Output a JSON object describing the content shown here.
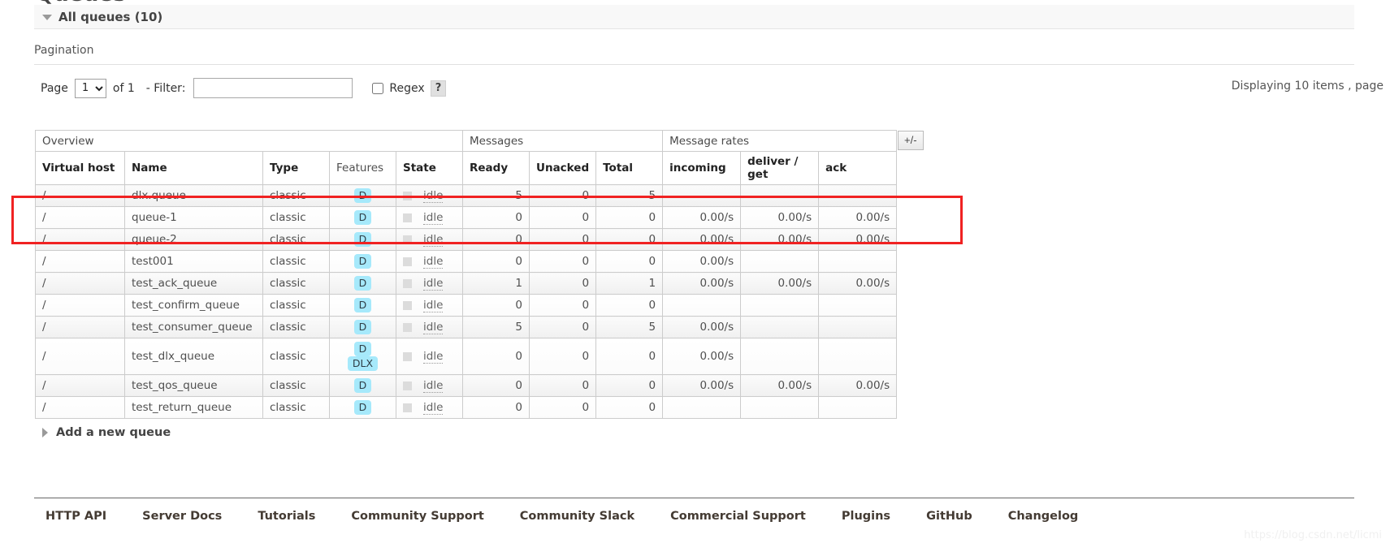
{
  "page_title": "Queues",
  "section": {
    "toggle_icon": "triangle-down-icon",
    "title": "All queues (10)"
  },
  "pagination": {
    "label": "Pagination",
    "page_label": "Page",
    "page_value": "1",
    "page_options": [
      "1"
    ],
    "of_label": "of 1",
    "filter_label": "- Filter:",
    "filter_value": "",
    "filter_placeholder": "",
    "regex_label": "Regex",
    "regex_checked": false,
    "help_label": "?",
    "displaying": "Displaying 10 items , page"
  },
  "table": {
    "group_headers": [
      "Overview",
      "Messages",
      "Message rates"
    ],
    "columns": [
      "Virtual host",
      "Name",
      "Type",
      "Features",
      "State",
      "Ready",
      "Unacked",
      "Total",
      "incoming",
      "deliver / get",
      "ack"
    ],
    "toggle_columns_label": "+/-",
    "state_text": "idle",
    "rows": [
      {
        "vhost": "/",
        "name": "dlx.queue",
        "type": "classic",
        "features": [
          "D"
        ],
        "state": "idle",
        "ready": "5",
        "unacked": "0",
        "total": "5",
        "incoming": "",
        "deliver_get": "",
        "ack": "",
        "highlighted": false
      },
      {
        "vhost": "/",
        "name": "queue-1",
        "type": "classic",
        "features": [
          "D"
        ],
        "state": "idle",
        "ready": "0",
        "unacked": "0",
        "total": "0",
        "incoming": "0.00/s",
        "deliver_get": "0.00/s",
        "ack": "0.00/s",
        "highlighted": true
      },
      {
        "vhost": "/",
        "name": "queue-2",
        "type": "classic",
        "features": [
          "D"
        ],
        "state": "idle",
        "ready": "0",
        "unacked": "0",
        "total": "0",
        "incoming": "0.00/s",
        "deliver_get": "0.00/s",
        "ack": "0.00/s",
        "highlighted": true
      },
      {
        "vhost": "/",
        "name": "test001",
        "type": "classic",
        "features": [
          "D"
        ],
        "state": "idle",
        "ready": "0",
        "unacked": "0",
        "total": "0",
        "incoming": "0.00/s",
        "deliver_get": "",
        "ack": "",
        "highlighted": false
      },
      {
        "vhost": "/",
        "name": "test_ack_queue",
        "type": "classic",
        "features": [
          "D"
        ],
        "state": "idle",
        "ready": "1",
        "unacked": "0",
        "total": "1",
        "incoming": "0.00/s",
        "deliver_get": "0.00/s",
        "ack": "0.00/s",
        "highlighted": false
      },
      {
        "vhost": "/",
        "name": "test_confirm_queue",
        "type": "classic",
        "features": [
          "D"
        ],
        "state": "idle",
        "ready": "0",
        "unacked": "0",
        "total": "0",
        "incoming": "",
        "deliver_get": "",
        "ack": "",
        "highlighted": false
      },
      {
        "vhost": "/",
        "name": "test_consumer_queue",
        "type": "classic",
        "features": [
          "D"
        ],
        "state": "idle",
        "ready": "5",
        "unacked": "0",
        "total": "5",
        "incoming": "0.00/s",
        "deliver_get": "",
        "ack": "",
        "highlighted": false
      },
      {
        "vhost": "/",
        "name": "test_dlx_queue",
        "type": "classic",
        "features": [
          "D",
          "DLX"
        ],
        "state": "idle",
        "ready": "0",
        "unacked": "0",
        "total": "0",
        "incoming": "0.00/s",
        "deliver_get": "",
        "ack": "",
        "highlighted": false
      },
      {
        "vhost": "/",
        "name": "test_qos_queue",
        "type": "classic",
        "features": [
          "D"
        ],
        "state": "idle",
        "ready": "0",
        "unacked": "0",
        "total": "0",
        "incoming": "0.00/s",
        "deliver_get": "0.00/s",
        "ack": "0.00/s",
        "highlighted": false
      },
      {
        "vhost": "/",
        "name": "test_return_queue",
        "type": "classic",
        "features": [
          "D"
        ],
        "state": "idle",
        "ready": "0",
        "unacked": "0",
        "total": "0",
        "incoming": "",
        "deliver_get": "",
        "ack": "",
        "highlighted": false
      }
    ]
  },
  "add_queue": {
    "toggle_icon": "triangle-right-icon",
    "label": "Add a new queue"
  },
  "footer": {
    "links": [
      "HTTP API",
      "Server Docs",
      "Tutorials",
      "Community Support",
      "Community Slack",
      "Commercial Support",
      "Plugins",
      "GitHub",
      "Changelog"
    ]
  },
  "watermark": "https://blog.csdn.net/licmi",
  "colors": {
    "feature_badge_bg": "#a6e9fb",
    "highlight_border": "#f02222",
    "section_bar_bg": "#f8f8f8"
  }
}
